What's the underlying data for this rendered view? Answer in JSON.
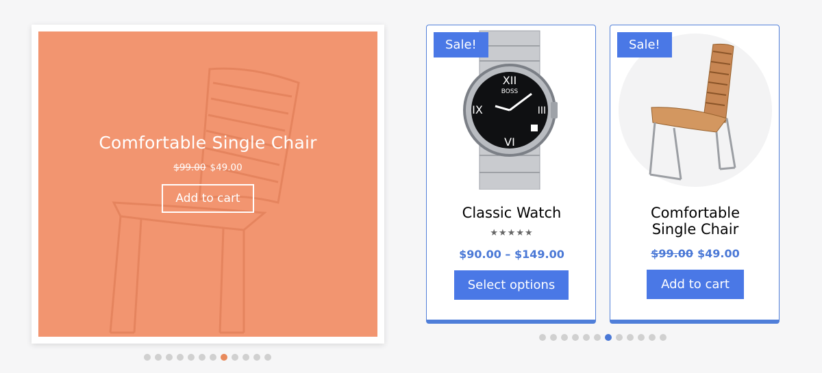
{
  "featured": {
    "title": "Comfortable Single Chair",
    "old_price": "$99.00",
    "price": "$49.00",
    "button": "Add to cart",
    "colors": {
      "overlay": "#f29570",
      "dot_active": "#e88a5c"
    },
    "dots_total": 12,
    "dots_active_index": 7
  },
  "products": [
    {
      "badge": "Sale!",
      "name": "Classic Watch",
      "rating_display": "★★★★★",
      "price_range": "$90.00 – $149.00",
      "button": "Select options",
      "brand_on_dial": "BOSS"
    },
    {
      "badge": "Sale!",
      "name_line1": "Comfortable",
      "name_line2": "Single Chair",
      "old_price": "$99.00",
      "price": "$49.00",
      "button": "Add to cart"
    }
  ],
  "carousel": {
    "dots_total": 12,
    "dots_active_index": 6,
    "colors": {
      "accent": "#4a78e6",
      "border": "#4f7ed9"
    },
    "prev_icon": "chevron-left-icon",
    "next_icon": "chevron-right-icon"
  }
}
